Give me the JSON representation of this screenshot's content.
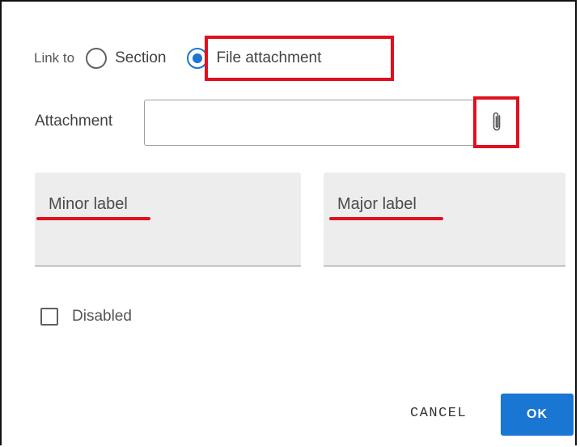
{
  "link_to": {
    "label": "Link to",
    "options": [
      {
        "label": "Section",
        "checked": false
      },
      {
        "label": "File attachment",
        "checked": true
      }
    ]
  },
  "attachment": {
    "label": "Attachment",
    "value": "",
    "placeholder": "",
    "button_icon": "paperclip-icon"
  },
  "fields": {
    "minor_label": "Minor label",
    "major_label": "Major label"
  },
  "disabled_checkbox": {
    "label": "Disabled",
    "checked": false
  },
  "actions": {
    "cancel": "CANCEL",
    "ok": "OK"
  },
  "colors": {
    "accent": "#1976d2",
    "annotation_red": "#e0101e",
    "field_bg": "#ededed"
  }
}
